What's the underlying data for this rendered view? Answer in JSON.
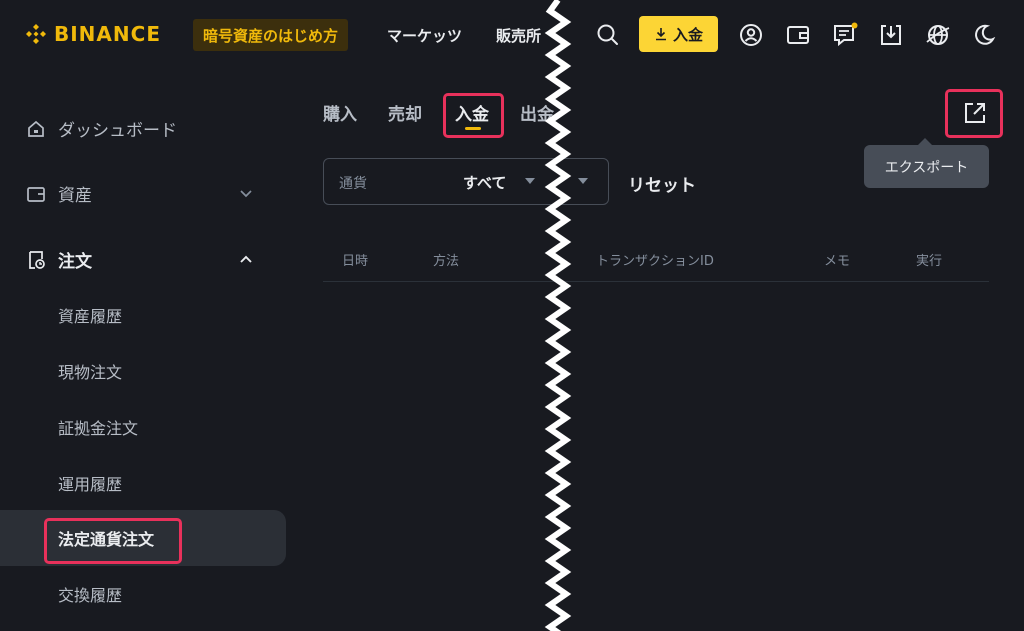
{
  "header": {
    "brand": "BINANCE",
    "guide_button": "暗号資産のはじめ方",
    "nav": [
      "マーケッツ",
      "販売所"
    ],
    "deposit_button": "入金",
    "brand_color": "#f0b90b",
    "icons": [
      "search-icon",
      "user-icon",
      "wallet-icon",
      "message-icon",
      "download-icon",
      "globe-icon",
      "moon-icon"
    ]
  },
  "sidebar": {
    "items": [
      {
        "label": "ダッシュボード",
        "icon": "home-icon"
      },
      {
        "label": "資産",
        "icon": "wallet-icon",
        "expand": "chevron-down-icon"
      },
      {
        "label": "注文",
        "icon": "order-icon",
        "expand": "chevron-up-icon"
      }
    ],
    "sub_items": [
      "資産履歴",
      "現物注文",
      "証拠金注文",
      "運用履歴",
      "法定通貨注文",
      "交換履歴"
    ],
    "active_sub_item": "法定通貨注文"
  },
  "main": {
    "tabs": [
      "購入",
      "売却",
      "入金",
      "出金"
    ],
    "active_tab": "入金",
    "filter": {
      "label": "通貨",
      "value": "すべて"
    },
    "reset": "リセット",
    "columns": [
      "日時",
      "方法",
      "トランザクションID",
      "メモ",
      "実行"
    ],
    "export_tooltip": "エクスポート"
  },
  "colors": {
    "accent": "#f0b90b",
    "highlight": "#e8315b",
    "background": "#181a20"
  }
}
